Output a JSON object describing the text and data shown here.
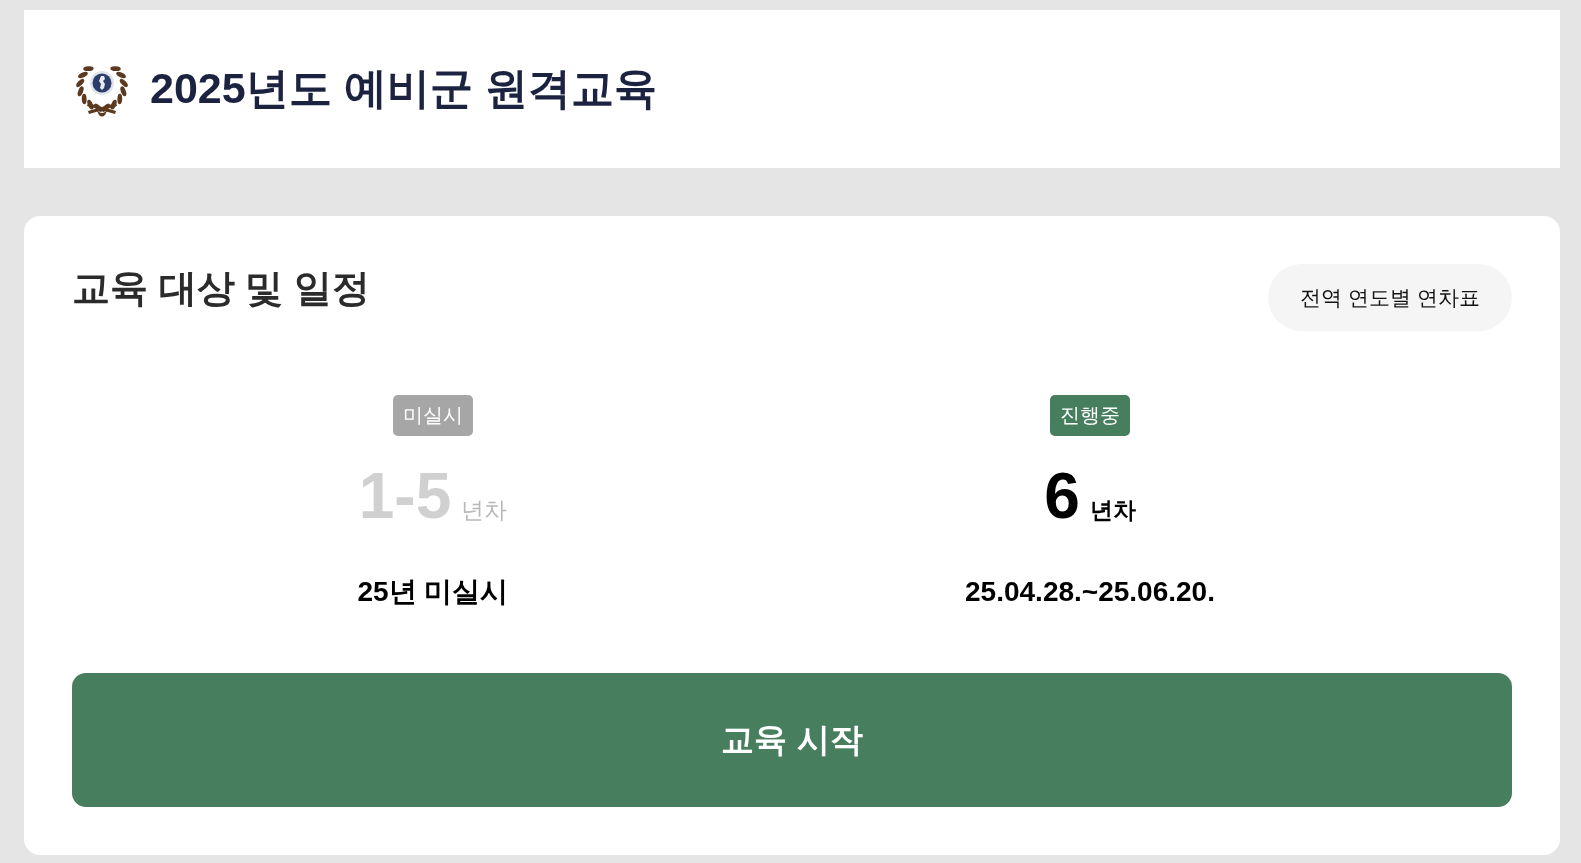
{
  "header": {
    "title": "2025년도 예비군 원격교육"
  },
  "schedule": {
    "title": "교육 대상 및 일정",
    "chart_button": "전역 연도별 연차표",
    "groups": [
      {
        "status": "미실시",
        "active": false,
        "years": "1-5",
        "unit": "년차",
        "period": "25년 미실시"
      },
      {
        "status": "진행중",
        "active": true,
        "years": "6",
        "unit": "년차",
        "period": "25.04.28.~25.06.20."
      }
    ],
    "start_button": "교육 시작"
  }
}
